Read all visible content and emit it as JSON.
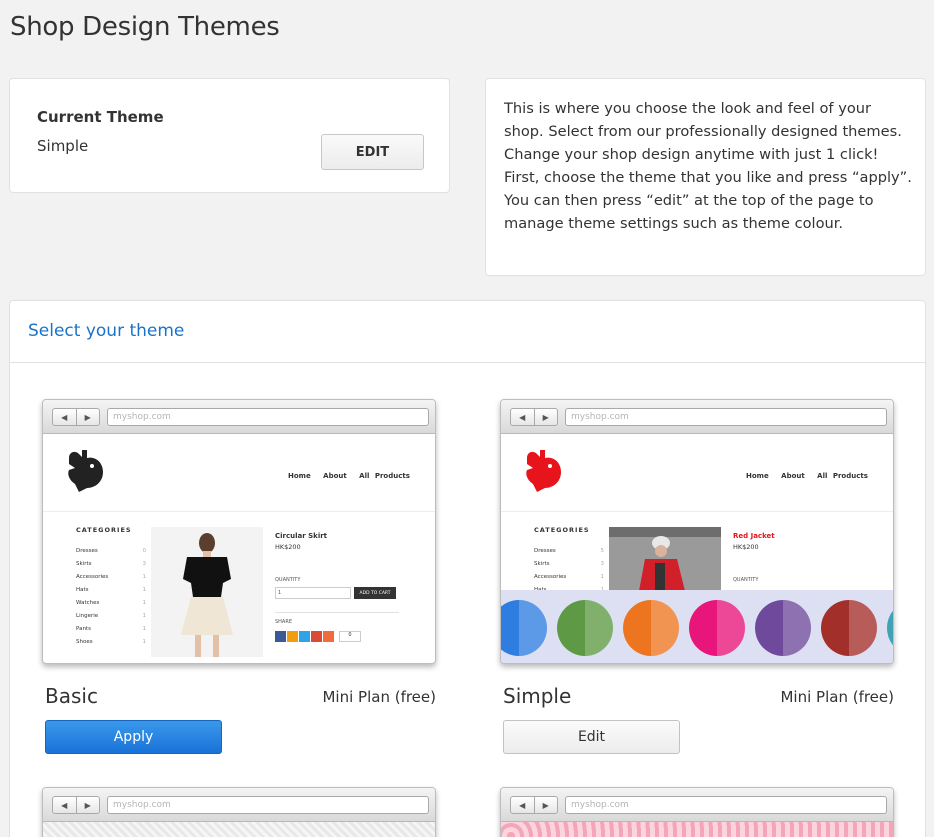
{
  "page": {
    "title": "Shop Design Themes"
  },
  "current_theme": {
    "label": "Current Theme",
    "name": "Simple",
    "edit_label": "EDIT"
  },
  "info": {
    "text": "This is where you choose the look and feel of your shop. Select from our professionally designed themes. Change your shop design anytime with just 1 click! First, choose the theme that you like and press “apply”. You can then press “edit” at the top of the page to manage theme settings such as theme colour."
  },
  "select_section": {
    "title": "Select your theme"
  },
  "preview_common": {
    "url": "myshop.com",
    "back": "◀",
    "forward": "▶",
    "nav": [
      "Home",
      "About",
      "All Products"
    ],
    "categories_title": "CATEGORIES",
    "quantity_label": "QUANTITY",
    "add_to_cart": "ADD TO CART",
    "share_label": "SHARE",
    "qty_value": "1",
    "share_count": "0"
  },
  "themes": [
    {
      "name": "Basic",
      "plan": "Mini Plan (free)",
      "button": "Apply",
      "logo_color": "#222222",
      "product_name": "Circular Skirt",
      "product_price": "HK$200",
      "categories": [
        {
          "name": "Dresses",
          "count": "0"
        },
        {
          "name": "Skirts",
          "count": "3"
        },
        {
          "name": "Accessories",
          "count": "1"
        },
        {
          "name": "Hats",
          "count": "1"
        },
        {
          "name": "Watches",
          "count": "1"
        },
        {
          "name": "Lingerie",
          "count": "1"
        },
        {
          "name": "Pants",
          "count": "1"
        },
        {
          "name": "Shoes",
          "count": "1"
        }
      ]
    },
    {
      "name": "Simple",
      "plan": "Mini Plan (free)",
      "button": "Edit",
      "logo_color": "#e8141c",
      "product_name": "Red Jacket",
      "product_price": "HK$200",
      "categories": [
        {
          "name": "Dresses",
          "count": "5"
        },
        {
          "name": "Skirts",
          "count": "3"
        },
        {
          "name": "Accessories",
          "count": "1"
        },
        {
          "name": "Hats",
          "count": "1"
        }
      ],
      "swatch_colors": [
        "#2f7de0",
        "#5e9a45",
        "#ee7520",
        "#e8157a",
        "#6f4a9c",
        "#a32f2a",
        "#3fa3b5"
      ]
    }
  ],
  "colors": {
    "accent": "#1a73d9",
    "link": "#1a73c9",
    "background": "#f2f2f2"
  }
}
